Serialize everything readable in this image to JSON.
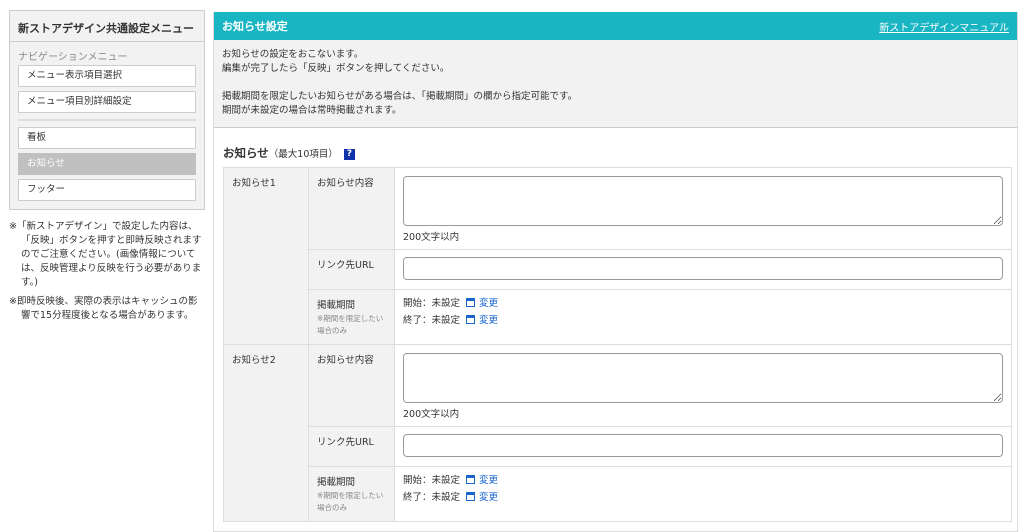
{
  "sidebar": {
    "title": "新ストアデザイン共通設定メニュー",
    "nav_label": "ナビゲーションメニュー",
    "items": [
      "メニュー表示項目選択",
      "メニュー項目別詳細設定"
    ],
    "items2": [
      "看板",
      "お知らせ",
      "フッター"
    ]
  },
  "notes": [
    "※「新ストアデザイン」で設定した内容は、「反映」ボタンを押すと即時反映されますのでご注意ください。(画像情報については、反映管理より反映を行う必要があります。)",
    "※即時反映後、実際の表示はキャッシュの影響で15分程度後となる場合があります。"
  ],
  "header": {
    "title": "お知らせ設定",
    "manual_link": "新ストアデザインマニュアル"
  },
  "info": [
    "お知らせの設定をおこないます。",
    "編集が完了したら「反映」ボタンを押してください。",
    "掲載期間を限定したいお知らせがある場合は、「掲載期間」の欄から指定可能です。",
    "期間が未設定の場合は常時掲載されます。"
  ],
  "section": {
    "title": "お知らせ",
    "note": "（最大10項目）",
    "help": "?"
  },
  "rows": [
    {
      "label": "お知らせ1",
      "content_label": "お知らせ内容",
      "limit": "200文字以内",
      "url_label": "リンク先URL",
      "period_label": "掲載期間",
      "period_note": "※期間を限定したい場合のみ",
      "start": "開始：未設定",
      "end": "終了：未設定",
      "change": "変更"
    },
    {
      "label": "お知らせ2",
      "content_label": "お知らせ内容",
      "limit": "200文字以内",
      "url_label": "リンク先URL",
      "period_label": "掲載期間",
      "period_note": "※期間を限定したい場合のみ",
      "start": "開始：未設定",
      "end": "終了：未設定",
      "change": "変更"
    }
  ]
}
